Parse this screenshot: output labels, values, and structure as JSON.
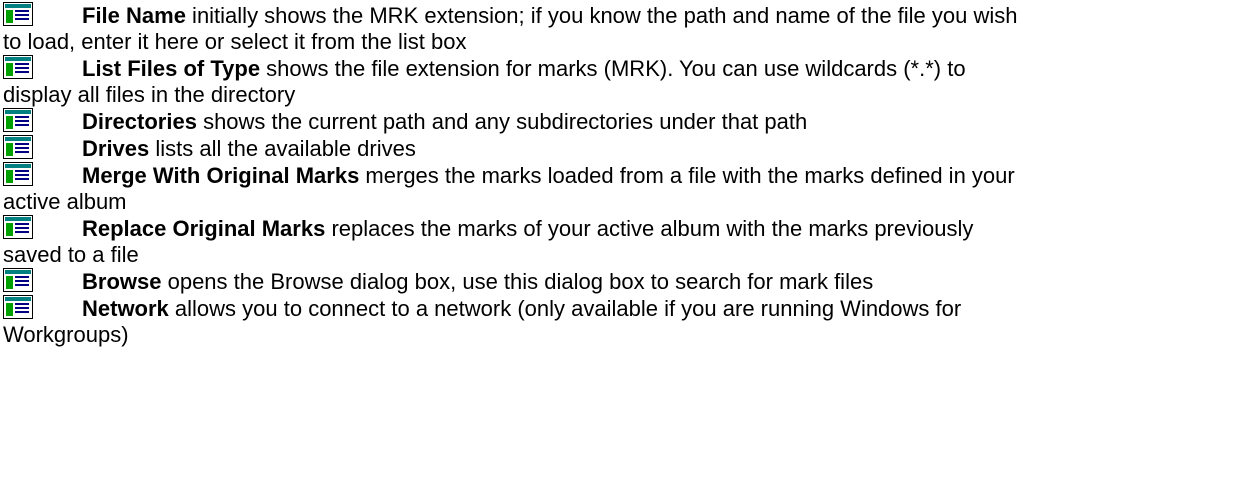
{
  "entries": [
    {
      "icon": "dialog-field-icon",
      "term": "File Name",
      "text_line1": " initially shows the MRK extension; if you know the path and name of the file you wish",
      "text_rest": "to load, enter it here or select it from the list box"
    },
    {
      "icon": "dialog-field-icon",
      "term": "List Files of Type",
      "text_line1": " shows the file extension for marks (MRK). You can use wildcards (*.*) to",
      "text_rest": "display all files in the directory"
    },
    {
      "icon": "dialog-field-icon",
      "term": "Directories",
      "text_line1": " shows the current path and any subdirectories under that path",
      "text_rest": ""
    },
    {
      "icon": "dialog-field-icon",
      "term": "Drives",
      "text_line1": " lists all the available drives",
      "text_rest": ""
    },
    {
      "icon": "dialog-field-icon",
      "term": "Merge With Original Marks",
      "text_line1": " merges the marks loaded from a file with the marks defined in your",
      "text_rest": "active album"
    },
    {
      "icon": "dialog-field-icon",
      "term": "Replace Original Marks",
      "text_line1": " replaces the marks of your active album with the marks previously",
      "text_rest": "saved to a file"
    },
    {
      "icon": "dialog-field-icon",
      "term": "Browse",
      "text_line1": " opens the Browse dialog box, use this dialog box to search for mark files",
      "text_rest": ""
    },
    {
      "icon": "dialog-field-icon",
      "term": "Network",
      "text_line1": " allows you to connect to a network (only available if you are running Windows for",
      "text_rest": "Workgroups)"
    }
  ],
  "colors": {
    "icon_border": "#000000",
    "icon_fill": "#ffffff",
    "icon_titlebar": "#008080",
    "icon_lines": "#000080",
    "icon_accent": "#00a000"
  }
}
